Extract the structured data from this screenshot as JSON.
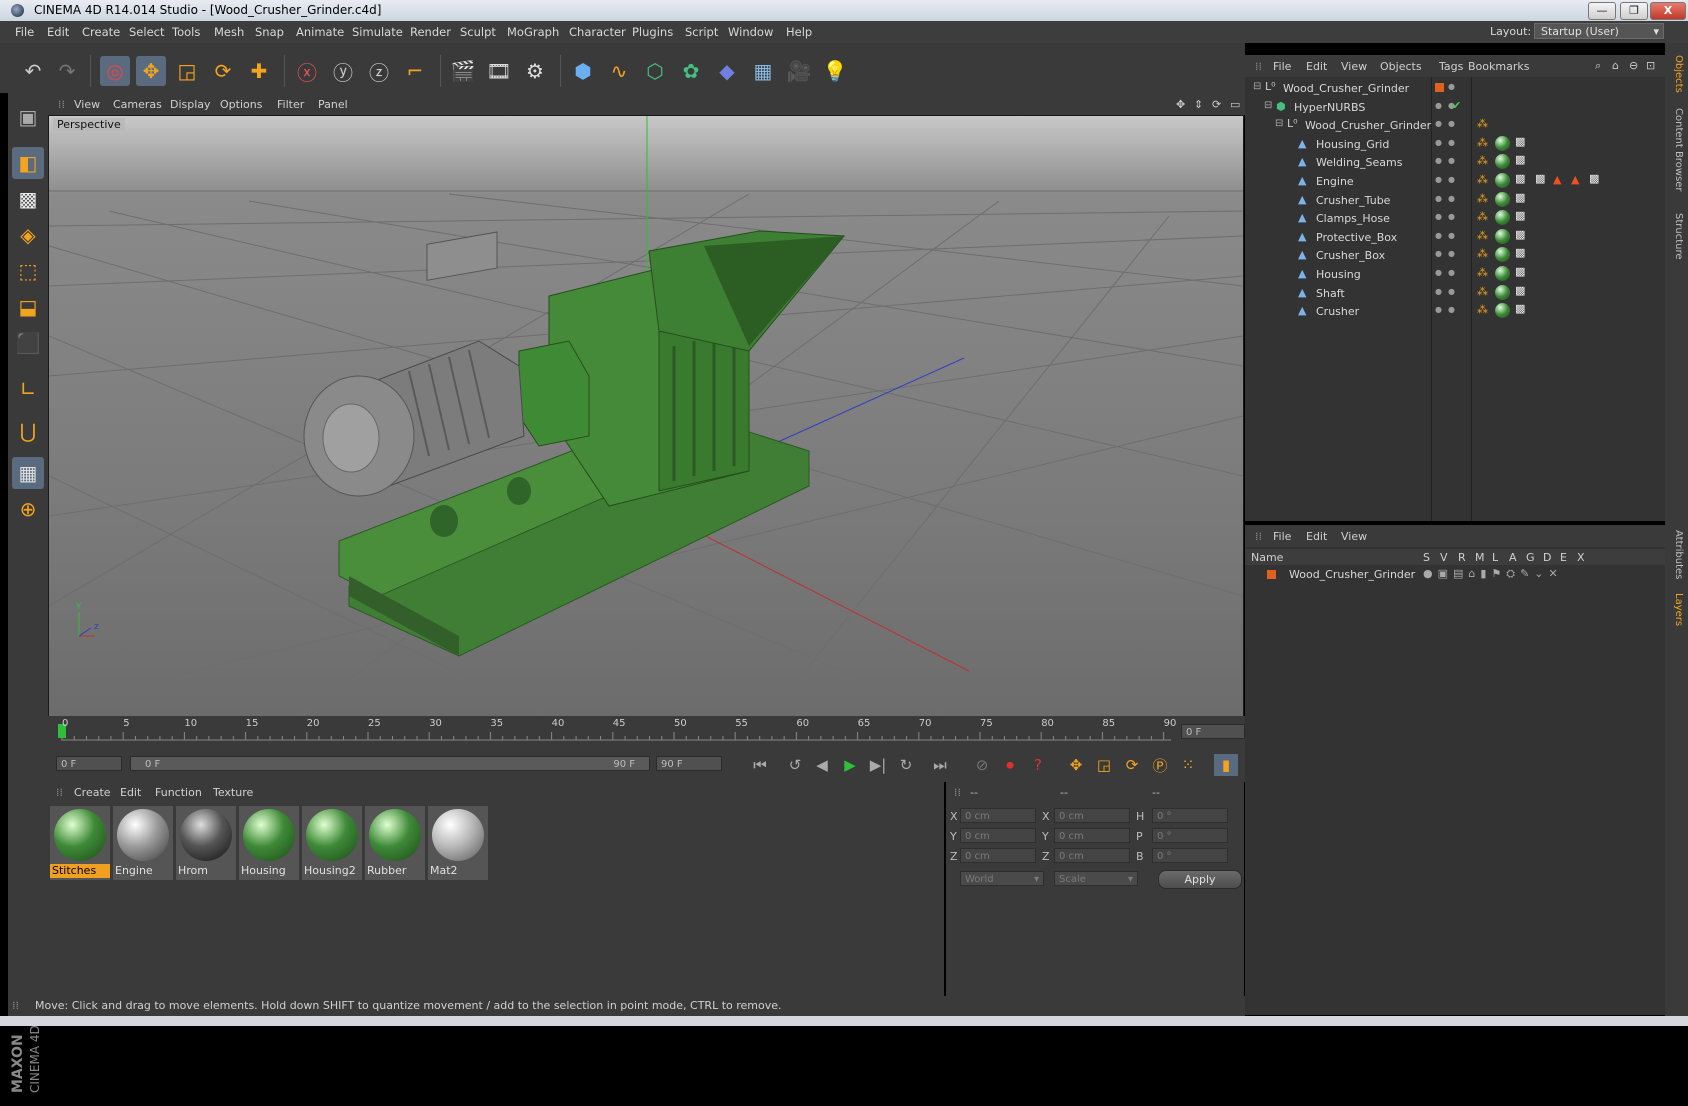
{
  "window": {
    "title": "CINEMA 4D R14.014 Studio - [Wood_Crusher_Grinder.c4d]",
    "min_label": "—",
    "max_label": "❐",
    "close_label": "X"
  },
  "menubar": {
    "items": [
      "File",
      "Edit",
      "Create",
      "Select",
      "Tools",
      "Mesh",
      "Snap",
      "Animate",
      "Simulate",
      "Render",
      "Sculpt",
      "MoGraph",
      "Character",
      "Plugins",
      "Script",
      "Window",
      "Help"
    ],
    "layout_label": "Layout:",
    "layout_value": "Startup (User)"
  },
  "viewport": {
    "menu": [
      "View",
      "Cameras",
      "Display",
      "Options",
      "Filter",
      "Panel"
    ],
    "label": "Perspective",
    "axis_x": "z",
    "axis_y": "Y",
    "colors": {
      "axis_red": "#d03030",
      "axis_green": "#30c030",
      "axis_blue": "#3040d0",
      "model_green": "#3f8a34"
    }
  },
  "timeline": {
    "ticks": [
      "0",
      "5",
      "10",
      "15",
      "20",
      "25",
      "30",
      "35",
      "40",
      "45",
      "50",
      "55",
      "60",
      "65",
      "70",
      "75",
      "80",
      "85",
      "90"
    ],
    "current_frame_field": "0 F",
    "start_field": "0 F",
    "range_start": "0 F",
    "range_end": "90 F",
    "end_field": "90 F"
  },
  "materials": {
    "menu": [
      "Create",
      "Edit",
      "Function",
      "Texture"
    ],
    "items": [
      {
        "name": "Stitches",
        "selected": true,
        "color": "#3e8a38"
      },
      {
        "name": "Engine",
        "selected": false,
        "color": "#9a9a9a"
      },
      {
        "name": "Hrom",
        "selected": false,
        "color": "#555"
      },
      {
        "name": "Housing",
        "selected": false,
        "color": "#3e8a38"
      },
      {
        "name": "Housing2",
        "selected": false,
        "color": "#3e8a38"
      },
      {
        "name": "Rubber",
        "selected": false,
        "color": "#3e8a38"
      },
      {
        "name": "Mat2",
        "selected": false,
        "color": "#b8b8b8"
      }
    ]
  },
  "coordinates": {
    "headers": [
      "--",
      "--",
      "--"
    ],
    "rows": [
      {
        "l1": "X",
        "v1": "0 cm",
        "l2": "X",
        "v2": "0 cm",
        "l3": "H",
        "v3": "0 °"
      },
      {
        "l1": "Y",
        "v1": "0 cm",
        "l2": "Y",
        "v2": "0 cm",
        "l3": "P",
        "v3": "0 °"
      },
      {
        "l1": "Z",
        "v1": "0 cm",
        "l2": "Z",
        "v2": "0 cm",
        "l3": "B",
        "v3": "0 °"
      }
    ],
    "mode_select": "World",
    "scale_select": "Scale",
    "apply_label": "Apply"
  },
  "statusbar": {
    "text": "Move: Click and drag to move elements. Hold down SHIFT to quantize movement / add to the selection in point mode, CTRL to remove."
  },
  "object_manager": {
    "menu": [
      "File",
      "Edit",
      "View",
      "Objects",
      "Tags",
      "Bookmarks"
    ],
    "objects": [
      {
        "name": "Wood_Crusher_Grinder",
        "level": 0
      },
      {
        "name": "HyperNURBS",
        "level": 1
      },
      {
        "name": "Wood_Crusher_Grinder",
        "level": 2
      },
      {
        "name": "Housing_Grid",
        "level": 3
      },
      {
        "name": "Welding_Seams",
        "level": 3
      },
      {
        "name": "Engine",
        "level": 3
      },
      {
        "name": "Crusher_Tube",
        "level": 3
      },
      {
        "name": "Clamps_Hose",
        "level": 3
      },
      {
        "name": "Protective_Box",
        "level": 3
      },
      {
        "name": "Crusher_Box",
        "level": 3
      },
      {
        "name": "Housing",
        "level": 3
      },
      {
        "name": "Shaft",
        "level": 3
      },
      {
        "name": "Crusher",
        "level": 3
      }
    ]
  },
  "layer_manager": {
    "menu": [
      "File",
      "Edit",
      "View"
    ],
    "columns": [
      "Name",
      "S",
      "V",
      "R",
      "M",
      "L",
      "A",
      "G",
      "D",
      "E",
      "X"
    ],
    "layers": [
      {
        "name": "Wood_Crusher_Grinder",
        "color": "#e06020"
      }
    ]
  },
  "right_tabs": [
    "Objects",
    "Content Browser",
    "Structure",
    "Attributes",
    "Layers"
  ],
  "logo_text": "MAXON CINEMA 4D"
}
